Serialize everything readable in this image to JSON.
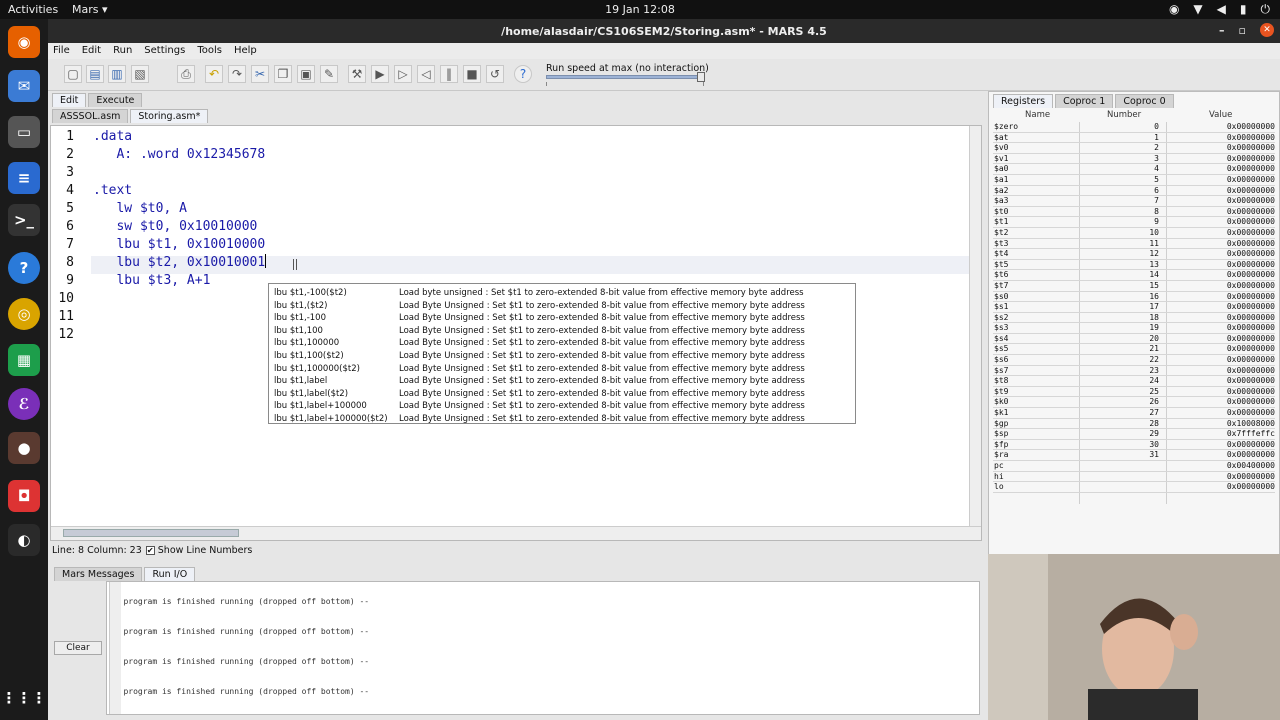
{
  "topbar": {
    "activities": "Activities",
    "app": "Mars ▾",
    "clock": "19 Jan 12:08"
  },
  "window": {
    "title": "/home/alasdair/CS106SEM2/Storing.asm* - MARS 4.5"
  },
  "menu": [
    "File",
    "Edit",
    "Run",
    "Settings",
    "Tools",
    "Help"
  ],
  "toolbar": {
    "speed_label": "Run speed at max (no interaction)",
    "speed_fraction": 1.0
  },
  "mode_tabs": [
    "Edit",
    "Execute"
  ],
  "file_tabs": [
    "ASSSOL.asm",
    "Storing.asm*"
  ],
  "editor": {
    "line_numbers": [
      "1",
      "2",
      "3",
      "4",
      "5",
      "6",
      "7",
      "8",
      "9",
      "10",
      "11",
      "12"
    ],
    "lines": [
      ".data",
      "   A: .word 0x12345678",
      "",
      ".text",
      "   lw $t0, A",
      "   sw $t0, 0x10010000",
      "   lbu $t1, 0x10010000",
      "   lbu $t2, 0x10010001",
      "   lbu $t3, A+1",
      "",
      "",
      ""
    ]
  },
  "autocomplete": [
    {
      "sig": "lbu $t1,-100($t2)",
      "desc": "Load byte unsigned : Set $t1 to zero-extended 8-bit value from effective memory byte address"
    },
    {
      "sig": "lbu $t1,($t2)",
      "desc": "Load Byte Unsigned : Set $t1 to zero-extended 8-bit value from effective memory byte address"
    },
    {
      "sig": "lbu $t1,-100",
      "desc": "Load Byte Unsigned : Set $t1 to zero-extended 8-bit value from effective memory byte address"
    },
    {
      "sig": "lbu $t1,100",
      "desc": "Load Byte Unsigned : Set $t1 to zero-extended 8-bit value from effective memory byte address"
    },
    {
      "sig": "lbu $t1,100000",
      "desc": "Load Byte Unsigned : Set $t1 to zero-extended 8-bit value from effective memory byte address"
    },
    {
      "sig": "lbu $t1,100($t2)",
      "desc": "Load Byte Unsigned : Set $t1 to zero-extended 8-bit value from effective memory byte address"
    },
    {
      "sig": "lbu $t1,100000($t2)",
      "desc": "Load Byte Unsigned : Set $t1 to zero-extended 8-bit value from effective memory byte address"
    },
    {
      "sig": "lbu $t1,label",
      "desc": "Load Byte Unsigned : Set $t1 to zero-extended 8-bit value from effective memory byte address"
    },
    {
      "sig": "lbu $t1,label($t2)",
      "desc": "Load Byte Unsigned : Set $t1 to zero-extended 8-bit value from effective memory byte address"
    },
    {
      "sig": "lbu $t1,label+100000",
      "desc": "Load Byte Unsigned : Set $t1 to zero-extended 8-bit value from effective memory byte address"
    },
    {
      "sig": "lbu $t1,label+100000($t2)",
      "desc": "Load Byte Unsigned : Set $t1 to zero-extended 8-bit value from effective memory byte address"
    }
  ],
  "status": {
    "position": "Line: 8 Column: 23",
    "show_line_numbers": "Show Line Numbers",
    "checked": "✔"
  },
  "register_tabs": [
    "Registers",
    "Coproc 1",
    "Coproc 0"
  ],
  "register_headers": [
    "Name",
    "Number",
    "Value"
  ],
  "registers": [
    [
      "$zero",
      "0",
      "0x00000000"
    ],
    [
      "$at",
      "1",
      "0x00000000"
    ],
    [
      "$v0",
      "2",
      "0x00000000"
    ],
    [
      "$v1",
      "3",
      "0x00000000"
    ],
    [
      "$a0",
      "4",
      "0x00000000"
    ],
    [
      "$a1",
      "5",
      "0x00000000"
    ],
    [
      "$a2",
      "6",
      "0x00000000"
    ],
    [
      "$a3",
      "7",
      "0x00000000"
    ],
    [
      "$t0",
      "8",
      "0x00000000"
    ],
    [
      "$t1",
      "9",
      "0x00000000"
    ],
    [
      "$t2",
      "10",
      "0x00000000"
    ],
    [
      "$t3",
      "11",
      "0x00000000"
    ],
    [
      "$t4",
      "12",
      "0x00000000"
    ],
    [
      "$t5",
      "13",
      "0x00000000"
    ],
    [
      "$t6",
      "14",
      "0x00000000"
    ],
    [
      "$t7",
      "15",
      "0x00000000"
    ],
    [
      "$s0",
      "16",
      "0x00000000"
    ],
    [
      "$s1",
      "17",
      "0x00000000"
    ],
    [
      "$s2",
      "18",
      "0x00000000"
    ],
    [
      "$s3",
      "19",
      "0x00000000"
    ],
    [
      "$s4",
      "20",
      "0x00000000"
    ],
    [
      "$s5",
      "21",
      "0x00000000"
    ],
    [
      "$s6",
      "22",
      "0x00000000"
    ],
    [
      "$s7",
      "23",
      "0x00000000"
    ],
    [
      "$t8",
      "24",
      "0x00000000"
    ],
    [
      "$t9",
      "25",
      "0x00000000"
    ],
    [
      "$k0",
      "26",
      "0x00000000"
    ],
    [
      "$k1",
      "27",
      "0x00000000"
    ],
    [
      "$gp",
      "28",
      "0x10008000"
    ],
    [
      "$sp",
      "29",
      "0x7fffeffc"
    ],
    [
      "$fp",
      "30",
      "0x00000000"
    ],
    [
      "$ra",
      "31",
      "0x00000000"
    ],
    [
      "pc",
      "",
      "0x00400000"
    ],
    [
      "hi",
      "",
      "0x00000000"
    ],
    [
      "lo",
      "",
      "0x00000000"
    ]
  ],
  "message_tabs": [
    "Mars Messages",
    "Run I/O"
  ],
  "clear_label": "Clear",
  "messages": [
    "-- program is finished running (dropped off bottom) --",
    "-- program is finished running (dropped off bottom) --",
    "-- program is finished running (dropped off bottom) --",
    "-- program is finished running (dropped off bottom) --"
  ]
}
